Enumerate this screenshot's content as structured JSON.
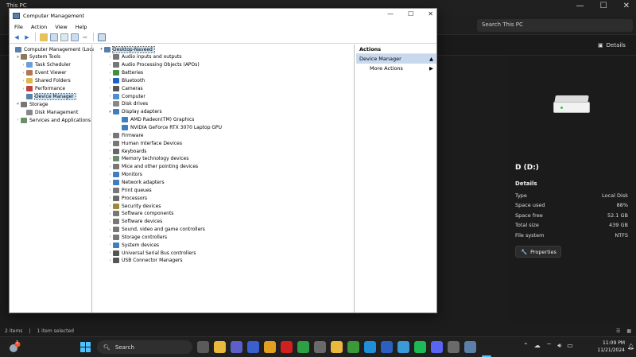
{
  "explorer": {
    "title": "This PC",
    "search_placeholder": "Search This PC",
    "details_link": "Details",
    "details_pane": {
      "drive_title": "D (D:)",
      "section": "Details",
      "rows": [
        {
          "label": "Type",
          "value": "Local Disk"
        },
        {
          "label": "Space used",
          "value": "88%"
        },
        {
          "label": "Space free",
          "value": "52.1 GB"
        },
        {
          "label": "Total size",
          "value": "439 GB"
        },
        {
          "label": "File system",
          "value": "NTFS"
        }
      ],
      "properties_button": "Properties"
    },
    "status": {
      "items": "2 items",
      "selected": "1 item selected"
    }
  },
  "cm": {
    "title": "Computer Management",
    "menu": [
      "File",
      "Action",
      "View",
      "Help"
    ],
    "left_tree": [
      {
        "label": "Computer Management (Local)",
        "level": 0,
        "exp": "",
        "icon": "computer-icon",
        "color": "#5a7fa8"
      },
      {
        "label": "System Tools",
        "level": 1,
        "exp": "v",
        "icon": "tools-icon",
        "color": "#8a7a5a"
      },
      {
        "label": "Task Scheduler",
        "level": 2,
        "exp": ">",
        "icon": "clock-icon",
        "color": "#6aa0d8"
      },
      {
        "label": "Event Viewer",
        "level": 2,
        "exp": ">",
        "icon": "event-viewer-icon",
        "color": "#b0785a"
      },
      {
        "label": "Shared Folders",
        "level": 2,
        "exp": ">",
        "icon": "folder-icon",
        "color": "#e2b64a"
      },
      {
        "label": "Performance",
        "level": 2,
        "exp": ">",
        "icon": "performance-icon",
        "color": "#c04040"
      },
      {
        "label": "Device Manager",
        "level": 2,
        "exp": "",
        "icon": "device-manager-icon",
        "color": "#5a7fa8",
        "selected": true
      },
      {
        "label": "Storage",
        "level": 1,
        "exp": "v",
        "icon": "storage-icon",
        "color": "#777777"
      },
      {
        "label": "Disk Management",
        "level": 2,
        "exp": "",
        "icon": "disk-icon",
        "color": "#888888"
      },
      {
        "label": "Services and Applications",
        "level": 1,
        "exp": ">",
        "icon": "services-icon",
        "color": "#6b8e6b"
      }
    ],
    "device_tree": [
      {
        "label": "Desktop-Naveed",
        "level": 0,
        "exp": "v",
        "icon": "computer-icon",
        "color": "#5a7fa8",
        "selected": true
      },
      {
        "label": "Audio inputs and outputs",
        "level": 1,
        "exp": ">",
        "icon": "speaker-icon",
        "color": "#777777"
      },
      {
        "label": "Audio Processing Objects (APOs)",
        "level": 1,
        "exp": ">",
        "icon": "audio-icon",
        "color": "#777777"
      },
      {
        "label": "Batteries",
        "level": 1,
        "exp": ">",
        "icon": "battery-icon",
        "color": "#3f8f3f"
      },
      {
        "label": "Bluetooth",
        "level": 1,
        "exp": ">",
        "icon": "bluetooth-icon",
        "color": "#1e5fcf"
      },
      {
        "label": "Cameras",
        "level": 1,
        "exp": ">",
        "icon": "camera-icon",
        "color": "#555555"
      },
      {
        "label": "Computer",
        "level": 1,
        "exp": ">",
        "icon": "computer-icon",
        "color": "#4a8fd8"
      },
      {
        "label": "Disk drives",
        "level": 1,
        "exp": ">",
        "icon": "disk-icon",
        "color": "#888888"
      },
      {
        "label": "Display adapters",
        "level": 1,
        "exp": "v",
        "icon": "display-icon",
        "color": "#3f7fbf"
      },
      {
        "label": "AMD Radeon(TM) Graphics",
        "level": 2,
        "exp": "",
        "icon": "display-icon",
        "color": "#3f7fbf"
      },
      {
        "label": "NVIDIA GeForce RTX 3070 Laptop GPU",
        "level": 2,
        "exp": "",
        "icon": "display-icon",
        "color": "#3f7fbf"
      },
      {
        "label": "Firmware",
        "level": 1,
        "exp": ">",
        "icon": "firmware-icon",
        "color": "#777777"
      },
      {
        "label": "Human Interface Devices",
        "level": 1,
        "exp": ">",
        "icon": "hid-icon",
        "color": "#777777"
      },
      {
        "label": "Keyboards",
        "level": 1,
        "exp": ">",
        "icon": "keyboard-icon",
        "color": "#666666"
      },
      {
        "label": "Memory technology devices",
        "level": 1,
        "exp": ">",
        "icon": "memory-icon",
        "color": "#6a8a6a"
      },
      {
        "label": "Mice and other pointing devices",
        "level": 1,
        "exp": ">",
        "icon": "mouse-icon",
        "color": "#777777"
      },
      {
        "label": "Monitors",
        "level": 1,
        "exp": ">",
        "icon": "monitor-icon",
        "color": "#3f7fbf"
      },
      {
        "label": "Network adapters",
        "level": 1,
        "exp": ">",
        "icon": "network-icon",
        "color": "#3f7fbf"
      },
      {
        "label": "Print queues",
        "level": 1,
        "exp": ">",
        "icon": "printer-icon",
        "color": "#777777"
      },
      {
        "label": "Processors",
        "level": 1,
        "exp": ">",
        "icon": "processor-icon",
        "color": "#6a6a6a"
      },
      {
        "label": "Security devices",
        "level": 1,
        "exp": ">",
        "icon": "security-icon",
        "color": "#a08a3a"
      },
      {
        "label": "Software components",
        "level": 1,
        "exp": ">",
        "icon": "software-icon",
        "color": "#777777"
      },
      {
        "label": "Software devices",
        "level": 1,
        "exp": ">",
        "icon": "software-icon",
        "color": "#777777"
      },
      {
        "label": "Sound, video and game controllers",
        "level": 1,
        "exp": ">",
        "icon": "sound-icon",
        "color": "#777777"
      },
      {
        "label": "Storage controllers",
        "level": 1,
        "exp": ">",
        "icon": "storage-icon",
        "color": "#777777"
      },
      {
        "label": "System devices",
        "level": 1,
        "exp": ">",
        "icon": "system-icon",
        "color": "#3f7fbf"
      },
      {
        "label": "Universal Serial Bus controllers",
        "level": 1,
        "exp": ">",
        "icon": "usb-icon",
        "color": "#555555"
      },
      {
        "label": "USB Connector Managers",
        "level": 1,
        "exp": ">",
        "icon": "usb-icon",
        "color": "#555555"
      }
    ],
    "actions": {
      "header": "Actions",
      "section": "Device Manager",
      "more": "More Actions"
    }
  },
  "taskbar": {
    "search_label": "Search",
    "weather_badge": "1",
    "clock_time": "11:09 PM",
    "clock_date": "11/21/2024",
    "apps": [
      {
        "name": "app-icon-1",
        "color": "#5a5a5a"
      },
      {
        "name": "file-explorer-icon",
        "color": "#e8b93a"
      },
      {
        "name": "teams-icon",
        "color": "#5b5fc7"
      },
      {
        "name": "app-icon-2",
        "color": "#3a5fcf"
      },
      {
        "name": "chrome-icon",
        "color": "#e0a020"
      },
      {
        "name": "opera-icon",
        "color": "#d02020"
      },
      {
        "name": "chrome-icon-2",
        "color": "#2ea043"
      },
      {
        "name": "calculator-icon",
        "color": "#6a6a6a"
      },
      {
        "name": "folder-icon",
        "color": "#e8b93a"
      },
      {
        "name": "chrome-icon-3",
        "color": "#3a9a3a"
      },
      {
        "name": "edge-icon",
        "color": "#1e8fd8"
      },
      {
        "name": "word-icon",
        "color": "#2b5fc0"
      },
      {
        "name": "photos-icon",
        "color": "#3a9ad8"
      },
      {
        "name": "spotify-icon",
        "color": "#1db954"
      },
      {
        "name": "discord-icon",
        "color": "#5865f2"
      },
      {
        "name": "settings-icon",
        "color": "#6a6a6a"
      },
      {
        "name": "computer-management-icon",
        "color": "#5a7fa8"
      }
    ]
  }
}
